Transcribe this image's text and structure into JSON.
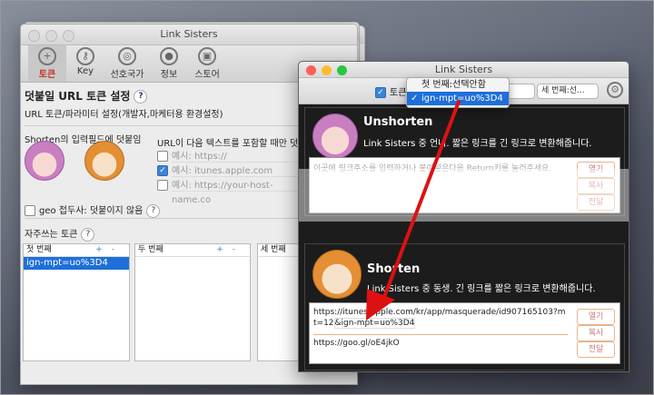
{
  "prefs": {
    "title": "Link Sisters",
    "toolbar": [
      "토큰",
      "Key",
      "선호국가",
      "정보",
      "스토어"
    ],
    "heading": "덧붙일 URL 토큰 설정",
    "subtitle": "URL 토큰/파라미터 설정(개발자,마케터용 환경설정)",
    "shorten_label": "Shorten의 입력필드에 덧붙임",
    "url_rule": "URL이 다음 텍스트를 포함할 때만 덧붙임",
    "examples": [
      "예시: https://",
      "예시: itunes.apple.com",
      "예시: https://your-host-name.co"
    ],
    "geo_label": "geo 접두사: 덧붙이지 않음",
    "fav_label": "자주쓰는 토큰",
    "panes": [
      {
        "head": "첫 번째",
        "rows": [
          "ign-mpt=uo%3D4"
        ]
      },
      {
        "head": "두 번째",
        "rows": []
      },
      {
        "head": "세 번째",
        "rows": []
      }
    ]
  },
  "ls": {
    "title": "Link Sisters",
    "token_label": "토큰:",
    "popup_third": "세 번째:선...",
    "dropdown": [
      "첫 번째:선택안함",
      "ign-mpt=uo%3D4"
    ],
    "unshorten": {
      "title": "Unshorten",
      "desc": "Link Sisters 중 언니. 짧은 링크를 긴 링크로 변환해줍니다.",
      "placeholder": "이곳에 링크주소를 입력하거나 붙여넣은다음 Return키를 눌러주세요."
    },
    "shorten": {
      "title": "Shorten",
      "desc": "Link Sisters 중 동생. 긴 링크를 짧은 링크로 변환해줍니다.",
      "url_line1": "https://itunes.apple.com/kr/app/masquerade/id907165103?m",
      "url_line2a": "t=12",
      "url_token": "&ign-mpt=uo%3D4",
      "short": "https://goo.gl/oE4jkO"
    },
    "buttons": [
      "열기",
      "복사",
      "전달"
    ]
  }
}
